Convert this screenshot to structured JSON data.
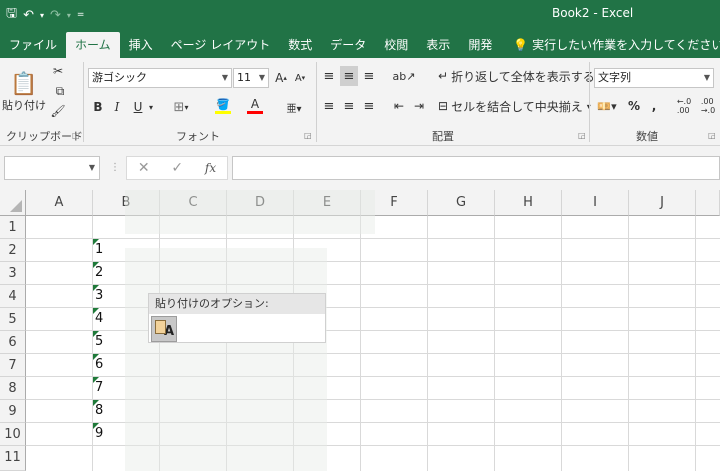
{
  "window": {
    "title": "Book2  -  Excel"
  },
  "qat": {
    "save_icon": "save-icon",
    "undo_icon": "undo-icon",
    "redo_icon": "redo-icon"
  },
  "tabs": [
    {
      "label": "ファイル",
      "active": false
    },
    {
      "label": "ホーム",
      "active": true
    },
    {
      "label": "挿入",
      "active": false
    },
    {
      "label": "ページ レイアウト",
      "active": false
    },
    {
      "label": "数式",
      "active": false
    },
    {
      "label": "データ",
      "active": false
    },
    {
      "label": "校閲",
      "active": false
    },
    {
      "label": "表示",
      "active": false
    },
    {
      "label": "開発",
      "active": false
    }
  ],
  "tell_me": "実行したい作業を入力してください",
  "ribbon": {
    "clipboard": {
      "paste_label": "貼り付け",
      "group_label": "クリップボード"
    },
    "font": {
      "font_name": "游ゴシック",
      "font_size": "11",
      "group_label": "フォント",
      "bold": "B",
      "italic": "I",
      "underline": "U"
    },
    "alignment": {
      "wrap_text": "折り返して全体を表示する",
      "merge_center": "セルを結合して中央揃え",
      "group_label": "配置"
    },
    "number": {
      "format": "文字列",
      "percent": "%",
      "comma": ",",
      "group_label": "数値"
    }
  },
  "formula_bar": {
    "name_box": "",
    "fx": "fx",
    "cancel": "✕",
    "enter": "✓",
    "value": ""
  },
  "columns": [
    "A",
    "B",
    "C",
    "D",
    "E",
    "F",
    "G",
    "H",
    "I",
    "J"
  ],
  "rows": [
    "1",
    "2",
    "3",
    "4",
    "5",
    "6",
    "7",
    "8",
    "9",
    "10",
    "11"
  ],
  "cells_b": [
    "",
    "1",
    "2",
    "3",
    "4",
    "5",
    "6",
    "7",
    "8",
    "9",
    ""
  ],
  "paste_options": {
    "title": "貼り付けのオプション:",
    "icon": "keep-text-only-icon",
    "letter": "A"
  },
  "colors": {
    "excel_green": "#217346",
    "error_triangle": "#1f7a3a"
  }
}
